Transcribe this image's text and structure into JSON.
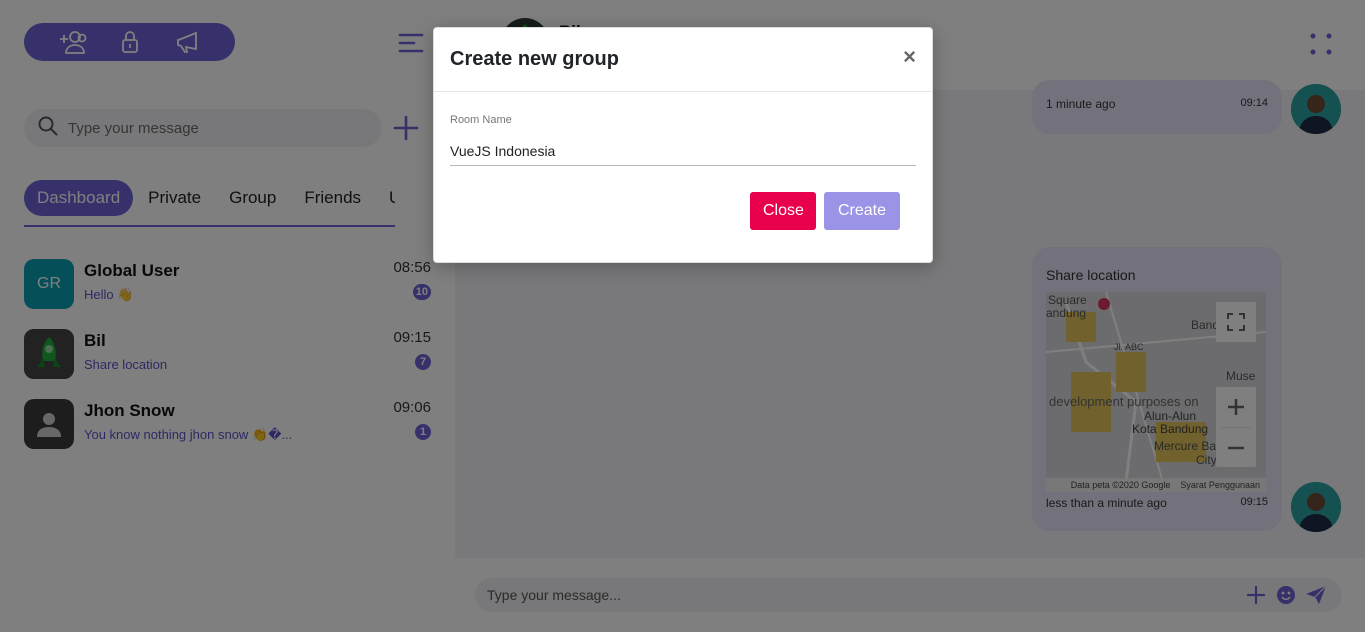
{
  "sidebar": {
    "search_placeholder": "Type your message",
    "tabs": [
      {
        "label": "Dashboard"
      },
      {
        "label": "Private"
      },
      {
        "label": "Group"
      },
      {
        "label": "Friends"
      },
      {
        "label": "Users"
      }
    ],
    "rooms": [
      {
        "initials": "GR",
        "name": "Global User",
        "last_message": "Hello 👋",
        "time": "08:56",
        "unread": "10",
        "avatar_color": "#0aa1b0"
      },
      {
        "initials": "",
        "name": "Bil",
        "last_message": "Share location",
        "time": "09:15",
        "unread": "7",
        "avatar_color": "#3d3d3d"
      },
      {
        "initials": "",
        "name": "Jhon Snow",
        "last_message": "You know nothing jhon snow 👏�...",
        "time": "09:06",
        "unread": "1",
        "avatar_color": "#3a3a3a"
      }
    ]
  },
  "chat": {
    "header_name": "Bil",
    "messages": [
      {
        "relative": "1 minute ago",
        "time": "09:14"
      },
      {
        "title": "Share location",
        "relative": "less than a minute ago",
        "time": "09:15"
      }
    ],
    "map": {
      "labels": {
        "square": "Square",
        "bandung_left": "andung",
        "bandung_right": "Bandu",
        "jl_abc": "Jl. ABC",
        "muse": "Muse",
        "dev": "development purposes on",
        "alun1": "Alun-Alun",
        "alun2": "Kota Bandung",
        "mercure": "Mercure Ban",
        "city": "City C",
        "data": "Data peta ©2020 Google",
        "terms": "Syarat Penggunaan"
      }
    },
    "composer_placeholder": "Type your message..."
  },
  "modal": {
    "title": "Create new group",
    "close_symbol": "×",
    "field_label": "Room Name",
    "field_value": "VueJS Indonesia",
    "close_label": "Close",
    "create_label": "Create"
  },
  "colors": {
    "accent": "#6c63d6",
    "danger": "#e8004a",
    "create_disabled": "#9a93e6"
  }
}
